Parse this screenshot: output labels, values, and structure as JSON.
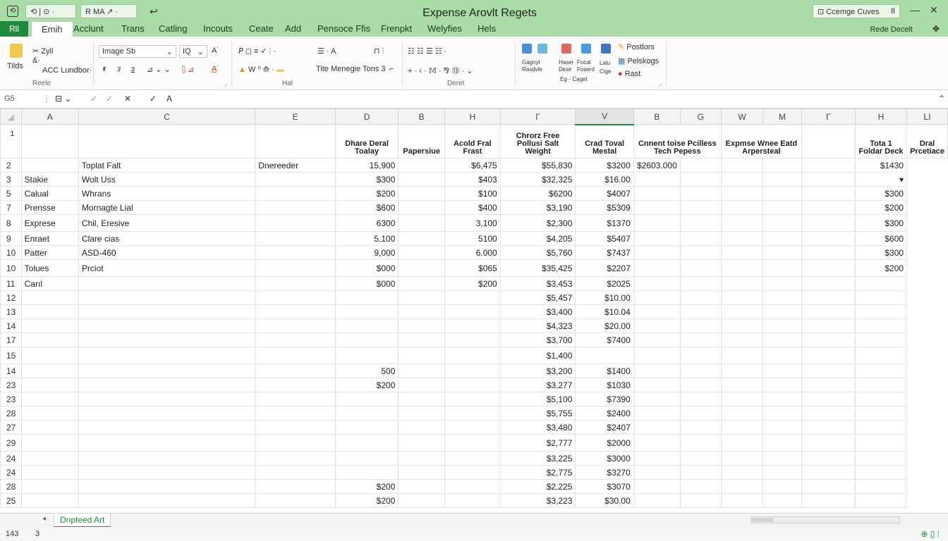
{
  "window": {
    "title": "Expense Arovlt Regets",
    "qat_left": "⟲ | ⊙ ·",
    "qat_mid": "R MA ↗ ·",
    "undo": "↩",
    "search": "Ccemge Cuves",
    "search_extra": "8",
    "minimize": "—",
    "close": "✕",
    "app_icon": "⟲"
  },
  "tabs": {
    "file": "Rll",
    "active": "Emih",
    "items": [
      "Acclunt",
      "Trans",
      "Catling",
      "Incouts",
      "Ceate",
      "Add",
      "Pensoce Ffis",
      "Frenpkt",
      "Welyfies",
      "Hels"
    ],
    "right": "Rede Decelt",
    "collapse": "✥"
  },
  "ribbon": {
    "paste_label": "Tilds",
    "cut": "Zyll",
    "copy": "&·",
    "format_painter": "ACC Lundbor·",
    "font_name": "Image Sb",
    "font_size": "IQ",
    "bold": "ғ",
    "italic": "ɜ",
    "underline": "ɜ",
    "group_clipboard": "Reele",
    "group_font": "Hal",
    "group_align": "Deret",
    "align_extra": "Tite Menegie Tons 3",
    "pos_label": "Postlors",
    "pelis_label": "Pelskogs",
    "rast_label": "Rast",
    "btn_gagnyl": "Gagnyl Rasdvle",
    "btn_haser": "Haser Desir",
    "btn_focal": "Focal Foserd",
    "btn_caget": "Eg·· Caget",
    "btn_lalu": "Lalu Cige",
    "font_a_label": "A"
  },
  "formula": {
    "namebox": "G5",
    "cancel": "✕",
    "confirm": "✓",
    "fx": "A"
  },
  "columns": [
    "A",
    "C",
    "E",
    "D",
    "B",
    "H",
    "Γ",
    "V",
    "B",
    "G",
    "W",
    "M",
    "Γ",
    "H",
    "LI"
  ],
  "headers": [
    "",
    "",
    "",
    "Dhare Deral Toalay",
    "Papersiue",
    "Acold Fral Frast",
    "Chrorz Free Pollusi Salt Weight",
    "Crad Toval Mestal",
    "Cnnent toise Pcilless Tech Pepess",
    "",
    "Expmse Wnee Eatd Arpersteal",
    "",
    "Tota 1 Foldar Deck",
    "Dral Prcetiace"
  ],
  "rows": [
    {
      "n": "2",
      "a": "",
      "c": "Toplat Falt",
      "e": "Dnereeder",
      "d": "15,900",
      "b": "",
      "h": "$6,475",
      "g1": "$55,830",
      "v": "$3200",
      "g": "$2603.000",
      "w": "",
      "m": "",
      "g2": "",
      "hh": "",
      "li": "$1430"
    },
    {
      "n": "3",
      "a": "Stakie",
      "c": "Wolt Uss",
      "e": "",
      "d": "$300",
      "b": "",
      "h": "$403",
      "g1": "$32,325",
      "v": "$16.00",
      "g": "",
      "w": "",
      "m": "",
      "g2": "",
      "hh": "",
      "li": "▾"
    },
    {
      "n": "5",
      "a": "Calual",
      "c": "Whrans",
      "e": "",
      "d": "$200",
      "b": "",
      "h": "$100",
      "g1": "$6200",
      "v": "$4007",
      "g": "",
      "w": "",
      "m": "",
      "g2": "",
      "hh": "",
      "li": "$300"
    },
    {
      "n": "7",
      "a": "Prensse",
      "c": "Mornagte Lial",
      "e": "",
      "d": "$600",
      "b": "",
      "h": "$400",
      "g1": "$3,190",
      "v": "$5309",
      "g": "",
      "w": "",
      "m": "",
      "g2": "",
      "hh": "",
      "li": "$200"
    },
    {
      "n": "8",
      "a": "Exprese",
      "c": "Chil, Eresive",
      "e": "",
      "d": "6300",
      "b": "",
      "h": "3,100",
      "g1": "$2,300",
      "v": "$1370",
      "g": "",
      "w": "",
      "m": "",
      "g2": "",
      "hh": "",
      "li": "$300",
      "tall": true
    },
    {
      "n": "9",
      "a": "Enraet",
      "c": "Clare cias",
      "e": "",
      "d": "5,100",
      "b": "",
      "h": "5100",
      "g1": "$4,205",
      "v": "$5407",
      "g": "",
      "w": "",
      "m": "",
      "g2": "",
      "hh": "",
      "li": "$600"
    },
    {
      "n": "10",
      "a": "Patter",
      "c": "ASD-460",
      "e": "",
      "d": "9,000",
      "b": "",
      "h": "6.000",
      "g1": "$5,760",
      "v": "$7437",
      "g": "",
      "w": "",
      "m": "",
      "g2": "",
      "hh": "",
      "li": "$300"
    },
    {
      "n": "10",
      "a": "Tolues",
      "c": "Prciot",
      "e": "",
      "d": "$000",
      "b": "",
      "h": "$065",
      "g1": "$35,425",
      "v": "$2207",
      "g": "",
      "w": "",
      "m": "",
      "g2": "",
      "hh": "",
      "li": "$200",
      "tall": true
    },
    {
      "n": "11",
      "a": "Carıl",
      "c": "",
      "e": "",
      "d": "$000",
      "b": "",
      "h": "$200",
      "g1": "$3,453",
      "v": "$2025",
      "g": "",
      "w": "",
      "m": "",
      "g2": "",
      "hh": "",
      "li": ""
    },
    {
      "n": "12",
      "a": "",
      "c": "",
      "e": "",
      "d": "",
      "b": "",
      "h": "",
      "g1": "$5,457",
      "v": "$10.00",
      "g": "",
      "w": "",
      "m": "",
      "g2": "",
      "hh": "",
      "li": ""
    },
    {
      "n": "13",
      "a": "",
      "c": "",
      "e": "",
      "d": "",
      "b": "",
      "h": "",
      "g1": "$3,400",
      "v": "$10.04",
      "g": "",
      "w": "",
      "m": "",
      "g2": "",
      "hh": "",
      "li": ""
    },
    {
      "n": "14",
      "a": "",
      "c": "",
      "e": "",
      "d": "",
      "b": "",
      "h": "",
      "g1": "$4,323",
      "v": "$20.00",
      "g": "",
      "w": "",
      "m": "",
      "g2": "",
      "hh": "",
      "li": ""
    },
    {
      "n": "17",
      "a": "",
      "c": "",
      "e": "",
      "d": "",
      "b": "",
      "h": "",
      "g1": "$3,700",
      "v": "$7400",
      "g": "",
      "w": "",
      "m": "",
      "g2": "",
      "hh": "",
      "li": ""
    },
    {
      "n": "15",
      "a": "",
      "c": "",
      "e": "",
      "d": "",
      "b": "",
      "h": "",
      "g1": "$1,400",
      "v": "",
      "g": "",
      "w": "",
      "m": "",
      "g2": "",
      "hh": "",
      "li": "",
      "tall": true
    },
    {
      "n": "14",
      "a": "",
      "c": "",
      "e": "",
      "d": "500",
      "b": "",
      "h": "",
      "g1": "$3,200",
      "v": "$1400",
      "g": "",
      "w": "",
      "m": "",
      "g2": "",
      "hh": "",
      "li": ""
    },
    {
      "n": "23",
      "a": "",
      "c": "",
      "e": "",
      "d": "$200",
      "b": "",
      "h": "",
      "g1": "$3,277",
      "v": "$1030",
      "g": "",
      "w": "",
      "m": "",
      "g2": "",
      "hh": "",
      "li": ""
    },
    {
      "n": "23",
      "a": "",
      "c": "",
      "e": "",
      "d": "",
      "b": "",
      "h": "",
      "g1": "$5,100",
      "v": "$7390",
      "g": "",
      "w": "",
      "m": "",
      "g2": "",
      "hh": "",
      "li": ""
    },
    {
      "n": "28",
      "a": "",
      "c": "",
      "e": "",
      "d": "",
      "b": "",
      "h": "",
      "g1": "$5,755",
      "v": "$2400",
      "g": "",
      "w": "",
      "m": "",
      "g2": "",
      "hh": "",
      "li": ""
    },
    {
      "n": "27",
      "a": "",
      "c": "",
      "e": "",
      "d": "",
      "b": "",
      "h": "",
      "g1": "$3,480",
      "v": "$2407",
      "g": "",
      "w": "",
      "m": "",
      "g2": "",
      "hh": "",
      "li": ""
    },
    {
      "n": "29",
      "a": "",
      "c": "",
      "e": "",
      "d": "",
      "b": "",
      "h": "",
      "g1": "$2,777",
      "v": "$2000",
      "g": "",
      "w": "",
      "m": "",
      "g2": "",
      "hh": "",
      "li": "",
      "tall": true
    },
    {
      "n": "24",
      "a": "",
      "c": "",
      "e": "",
      "d": "",
      "b": "",
      "h": "",
      "g1": "$3,225",
      "v": "$3000",
      "g": "",
      "w": "",
      "m": "",
      "g2": "",
      "hh": "",
      "li": ""
    },
    {
      "n": "24",
      "a": "",
      "c": "",
      "e": "",
      "d": "",
      "b": "",
      "h": "",
      "g1": "$2,775",
      "v": "$3270",
      "g": "",
      "w": "",
      "m": "",
      "g2": "",
      "hh": "",
      "li": ""
    },
    {
      "n": "28",
      "a": "",
      "c": "",
      "e": "",
      "d": "$200",
      "b": "",
      "h": "",
      "g1": "$2,225",
      "v": "$3070",
      "g": "",
      "w": "",
      "m": "",
      "g2": "",
      "hh": "",
      "li": ""
    },
    {
      "n": "25",
      "a": "",
      "c": "",
      "e": "",
      "d": "$200",
      "b": "",
      "h": "",
      "g1": "$3,223",
      "v": "$30.00",
      "g": "",
      "w": "",
      "m": "",
      "g2": "",
      "hh": "",
      "li": ""
    }
  ],
  "sheet": {
    "nav": "◂",
    "tab": "Dnpteed Art"
  },
  "status": {
    "left": "143",
    "mid": "3",
    "right": "⊕ ▯ ⁞"
  },
  "colors": {
    "accent": "#1e8c3c",
    "titlebar": "#a9dca6"
  }
}
